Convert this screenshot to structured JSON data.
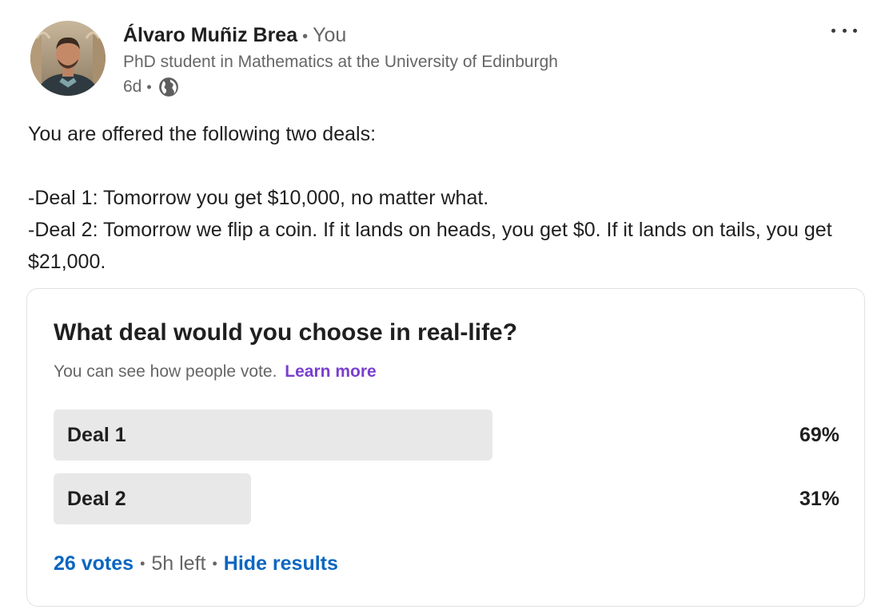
{
  "author": {
    "name": "Álvaro Muñiz Brea",
    "separator": "•",
    "relation": "You",
    "headline": "PhD student in Mathematics at the University of Edinburgh",
    "time": "6d",
    "visibility_icon": "globe-icon"
  },
  "menu_icon": "more-horizontal-icon",
  "post": {
    "line1": "You are offered the following two deals:",
    "line2": "-Deal 1: Tomorrow you get $10,000, no matter what.",
    "line3": "-Deal 2: Tomorrow we flip a coin. If it lands on heads, you get $0. If it lands on tails, you get $21,000."
  },
  "poll": {
    "question": "What deal would you choose in real-life?",
    "subtitle": "You can see how people vote.",
    "learn_more": "Learn more",
    "options": [
      {
        "label": "Deal 1",
        "percent_text": "69%",
        "percent": 69
      },
      {
        "label": "Deal 2",
        "percent_text": "31%",
        "percent": 31
      }
    ],
    "votes": "26 votes",
    "time_left": "5h left",
    "hide_results": "Hide results"
  },
  "colors": {
    "link_blue": "#0a66c2",
    "learn_more_purple": "#7a3fce",
    "bar_gray": "#e8e8e8",
    "muted_text": "#666666"
  }
}
